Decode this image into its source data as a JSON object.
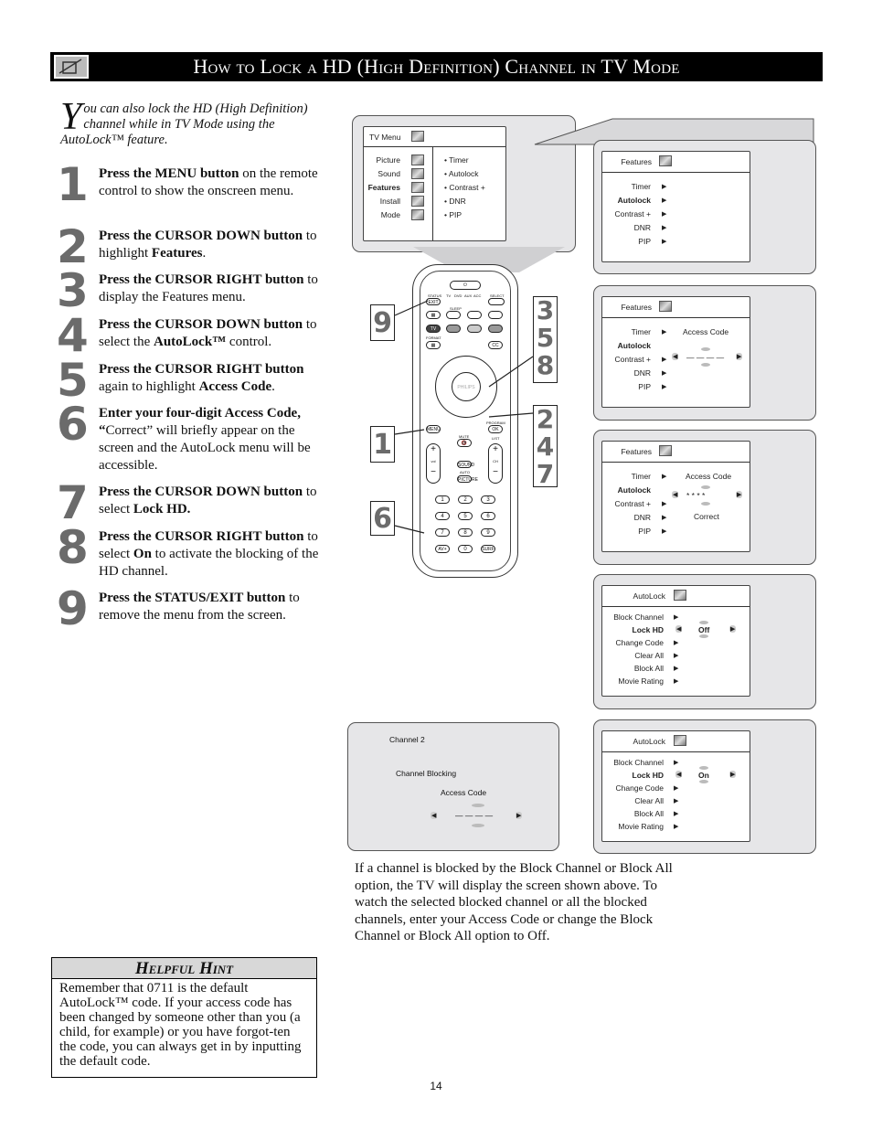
{
  "header": {
    "icon": "lock-pencil-icon",
    "title": "How to Lock a HD (High Definition) Channel in TV Mode"
  },
  "intro": {
    "dropcap": "Y",
    "text": "ou can also lock the HD (High Definition) channel while in TV Mode using the AutoLock™ feature."
  },
  "steps": [
    {
      "num": "1",
      "bold": "Press the MENU button",
      "rest": " on the remote control to show the onscreen menu."
    },
    {
      "num": "2",
      "bold": "Press the CURSOR DOWN button",
      "rest": " to highlight ",
      "bold2": "Features",
      "rest2": "."
    },
    {
      "num": "3",
      "bold": "Press the CURSOR RIGHT button",
      "rest": " to display the Features menu."
    },
    {
      "num": "4",
      "bold": "Press the CURSOR DOWN button",
      "rest": " to select the ",
      "bold2": "AutoLock™",
      "rest2": " control."
    },
    {
      "num": "5",
      "bold": "Press the CURSOR RIGHT button",
      "rest": " again to highlight ",
      "bold2": "Access Code",
      "rest2": "."
    },
    {
      "num": "6",
      "bold": "Enter your four-digit Access Code, “",
      "rest": "Correct” will briefly appear on the screen and the AutoLock menu will be accessible."
    },
    {
      "num": "7",
      "bold": "Press the CURSOR DOWN button",
      "rest": " to select ",
      "bold2": "Lock HD.",
      "rest2": ""
    },
    {
      "num": "8",
      "bold": "Press the CURSOR RIGHT button",
      "rest": " to select ",
      "bold2": "On",
      "rest2": " to activate the blocking of the HD channel."
    },
    {
      "num": "9",
      "bold": "Press the STATUS/EXIT button",
      "rest": " to remove the menu from the screen."
    }
  ],
  "hint": {
    "title": "Helpful Hint",
    "body": "Remember that 0711 is the default AutoLock™ code.  If your access code has been changed by someone other than you (a child, for example) or you have forgot-ten the code, you can always get in by inputting the default code."
  },
  "tv_menu": {
    "title": "TV Menu",
    "items": [
      "Picture",
      "Sound",
      "Features",
      "Install",
      "Mode"
    ],
    "highlighted": "Features",
    "submenu": [
      "Timer",
      "Autolock",
      "Contrast +",
      "DNR",
      "PIP"
    ]
  },
  "features_menus": [
    {
      "title": "Features",
      "items": [
        "Timer",
        "Autolock",
        "Contrast +",
        "DNR",
        "PIP"
      ],
      "highlighted": "Autolock"
    },
    {
      "title": "Features",
      "items": [
        "Timer",
        "Autolock",
        "Contrast +",
        "DNR",
        "PIP"
      ],
      "highlighted": "Autolock",
      "access_label": "Access Code",
      "code": "— — — —"
    },
    {
      "title": "Features",
      "items": [
        "Timer",
        "Autolock",
        "Contrast +",
        "DNR",
        "PIP"
      ],
      "highlighted": "Autolock",
      "access_label": "Access Code",
      "code": "* * * *",
      "status": "Correct"
    }
  ],
  "autolock_menus": [
    {
      "title": "AutoLock",
      "items": [
        "Block Channel",
        "Lock HD",
        "Change Code",
        "Clear All",
        "Block All",
        "Movie Rating"
      ],
      "highlighted": "Lock HD",
      "value": "Off"
    },
    {
      "title": "AutoLock",
      "items": [
        "Block Channel",
        "Lock HD",
        "Change Code",
        "Clear All",
        "Block All",
        "Movie Rating"
      ],
      "highlighted": "Lock HD",
      "value": "On"
    }
  ],
  "blocked_screen": {
    "channel": "Channel 2",
    "label": "Channel Blocking",
    "access_label": "Access Code",
    "code": "— — — —"
  },
  "remote": {
    "brand": "PHILIPS",
    "labels": {
      "status": "STATUS",
      "exit": "EXIT",
      "tv": "TV",
      "dvd": "DVD",
      "aux": "AUX",
      "acc": "ACC",
      "select": "SELECT",
      "sleep": "SLEEP",
      "format": "FORMAT",
      "cc": "CC",
      "menu": "MENU",
      "program": "PROGRAM",
      "ok": "OK",
      "mute": "MUTE",
      "list": "LIST",
      "vol": "vol",
      "ch": "CH",
      "sound": "SOUND",
      "auto": "AUTO",
      "picture": "PICTURE",
      "av": "AV+",
      "surf": "SURF",
      "color_tv": "TV"
    },
    "digits": [
      "1",
      "2",
      "3",
      "4",
      "5",
      "6",
      "7",
      "8",
      "9",
      "0"
    ],
    "callouts": {
      "exit": "9",
      "nav_upper": "3\n5\n8",
      "nav_lower": "2\n4\n7",
      "menu": "1",
      "digits": "6"
    }
  },
  "note": "If a channel is blocked by the Block Channel or Block All option, the TV will display the screen shown above. To watch the selected blocked channel or all the blocked channels, enter your Access Code or change the Block Channel or Block All option to Off.",
  "page_number": "14"
}
